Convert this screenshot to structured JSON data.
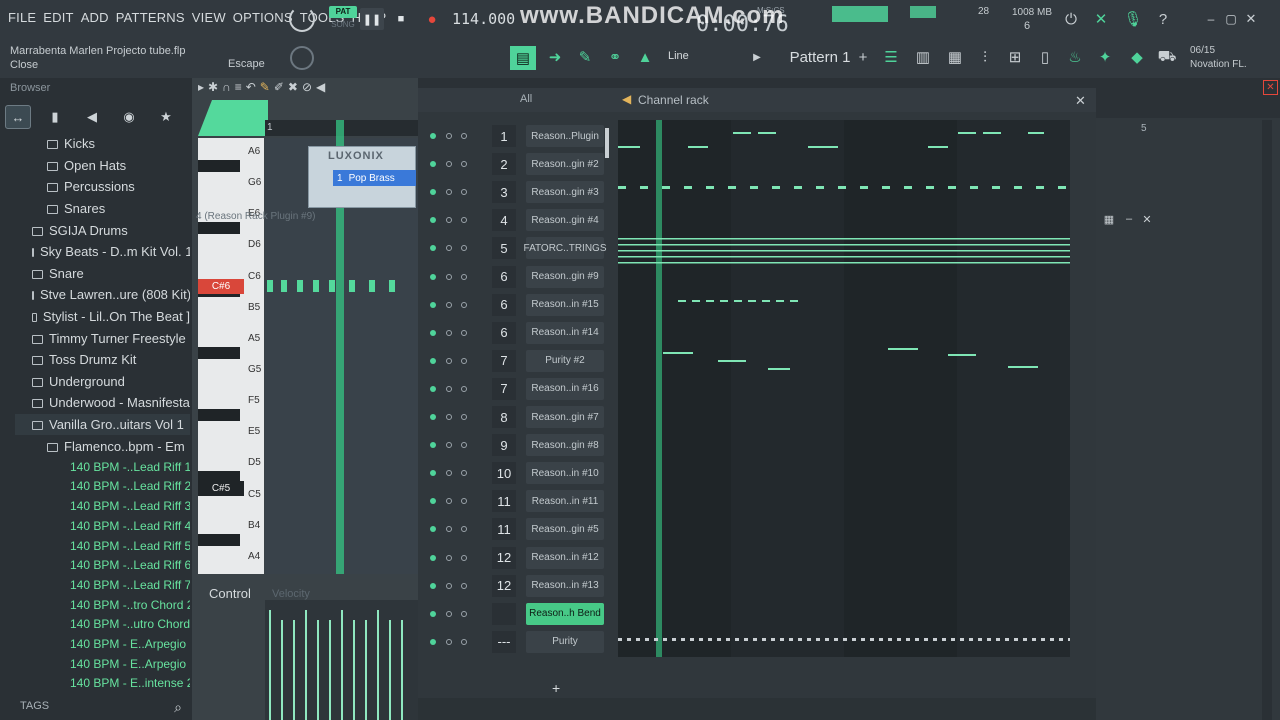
{
  "menu": [
    "FILE",
    "EDIT",
    "ADD",
    "PATTERNS",
    "VIEW",
    "OPTIONS",
    "TOOLS",
    "HELP"
  ],
  "transport": {
    "pat_label": "PAT",
    "song_label": "SONG",
    "tempo": "114.000",
    "time": "0:00:76",
    "time_units": "M:S:CS"
  },
  "watermark": "www.BANDICAM.com",
  "system": {
    "cpu": "28",
    "memory": "1008 MB",
    "polyphony": "6"
  },
  "project": {
    "file": "Marrabenta Marlen Projecto tube.flp",
    "hint": "Close",
    "escape": "Escape"
  },
  "toolbar": {
    "snap": "Line",
    "pattern": "Pattern 1",
    "pattern_add": "+"
  },
  "midi": {
    "date": "06/15",
    "device": "Novation FL."
  },
  "browser": {
    "title": "Browser",
    "items": [
      {
        "label": "Kicks",
        "level": 2,
        "type": "folder"
      },
      {
        "label": "Open Hats",
        "level": 2,
        "type": "folder"
      },
      {
        "label": "Percussions",
        "level": 2,
        "type": "folder"
      },
      {
        "label": "Snares",
        "level": 2,
        "type": "folder"
      },
      {
        "label": "SGIJA Drums",
        "level": 1,
        "type": "folder"
      },
      {
        "label": "Sky Beats - D..m Kit Vol. 1",
        "level": 1,
        "type": "folder"
      },
      {
        "label": "Snare",
        "level": 1,
        "type": "folder"
      },
      {
        "label": "Stve Lawren..ure (808 Kit)",
        "level": 1,
        "type": "folder"
      },
      {
        "label": "Stylist - Lil..On The Beat ]",
        "level": 1,
        "type": "folder"
      },
      {
        "label": "Timmy Turner Freestyle",
        "level": 1,
        "type": "folder"
      },
      {
        "label": "Toss Drumz Kit",
        "level": 1,
        "type": "folder"
      },
      {
        "label": "Underground",
        "level": 1,
        "type": "folder"
      },
      {
        "label": "Underwood - Masnifesta",
        "level": 1,
        "type": "folder"
      },
      {
        "label": "Vanilla Gro..uitars Vol 1",
        "level": 1,
        "type": "folder",
        "selected": true
      },
      {
        "label": "Flamenco..bpm - Em",
        "level": 2,
        "type": "folder"
      },
      {
        "label": "140 BPM -..Lead Riff 1",
        "level": 3,
        "type": "file"
      },
      {
        "label": "140 BPM -..Lead Riff 2",
        "level": 3,
        "type": "file"
      },
      {
        "label": "140 BPM -..Lead Riff 3",
        "level": 3,
        "type": "file"
      },
      {
        "label": "140 BPM -..Lead Riff 4",
        "level": 3,
        "type": "file"
      },
      {
        "label": "140 BPM -..Lead Riff 5",
        "level": 3,
        "type": "file"
      },
      {
        "label": "140 BPM -..Lead Riff 6",
        "level": 3,
        "type": "file"
      },
      {
        "label": "140 BPM -..Lead Riff 7",
        "level": 3,
        "type": "file"
      },
      {
        "label": "140 BPM -..tro Chord 2",
        "level": 3,
        "type": "file"
      },
      {
        "label": "140 BPM -..utro Chord",
        "level": 3,
        "type": "file"
      },
      {
        "label": "140 BPM - E..Arpegio 1",
        "level": 3,
        "type": "file"
      },
      {
        "label": "140 BPM - E..Arpegio 2",
        "level": 3,
        "type": "file"
      },
      {
        "label": "140 BPM - E..intense 2",
        "level": 3,
        "type": "file"
      }
    ],
    "tags": "TAGS"
  },
  "piano_roll": {
    "keys": [
      "A6",
      "G6",
      "E6",
      "D6",
      "C6",
      "B5",
      "A5",
      "G5",
      "F5",
      "E5",
      "D5",
      "C5",
      "B4",
      "A4"
    ],
    "highlight_key": "C#6",
    "dark_key": "C#5",
    "plugin_title": "LUXONIX",
    "plugin_preset": "Pop Brass",
    "plugin_preset_num": "1",
    "window_title": "4 (Reason Rack Plugin #9)",
    "control": "Control",
    "velocity": "Velocity",
    "bar": "1"
  },
  "channel_rack": {
    "title": "Channel rack",
    "filter": "All",
    "channels": [
      {
        "num": "1",
        "name": "Reason..Plugin"
      },
      {
        "num": "2",
        "name": "Reason..gin #2"
      },
      {
        "num": "3",
        "name": "Reason..gin #3"
      },
      {
        "num": "4",
        "name": "Reason..gin #4"
      },
      {
        "num": "5",
        "name": "FATORC..TRINGS"
      },
      {
        "num": "6",
        "name": "Reason..gin #9"
      },
      {
        "num": "6",
        "name": "Reason..in #15"
      },
      {
        "num": "6",
        "name": "Reason..in #14"
      },
      {
        "num": "7",
        "name": "Purity #2"
      },
      {
        "num": "7",
        "name": "Reason..in #16"
      },
      {
        "num": "8",
        "name": "Reason..gin #7"
      },
      {
        "num": "9",
        "name": "Reason..gin #8"
      },
      {
        "num": "10",
        "name": "Reason..in #10"
      },
      {
        "num": "11",
        "name": "Reason..in #11"
      },
      {
        "num": "11",
        "name": "Reason..gin #5"
      },
      {
        "num": "12",
        "name": "Reason..in #12"
      },
      {
        "num": "12",
        "name": "Reason..in #13"
      },
      {
        "num": "",
        "name": "Reason..h Bend",
        "highlight": true
      },
      {
        "num": "---",
        "name": "Purity"
      }
    ],
    "add": "+"
  },
  "playlist": {
    "bar": "5"
  },
  "colors": {
    "accent": "#4fd39a",
    "record": "#e5473b",
    "panel": "#30373c",
    "topbar": "#32393f"
  }
}
